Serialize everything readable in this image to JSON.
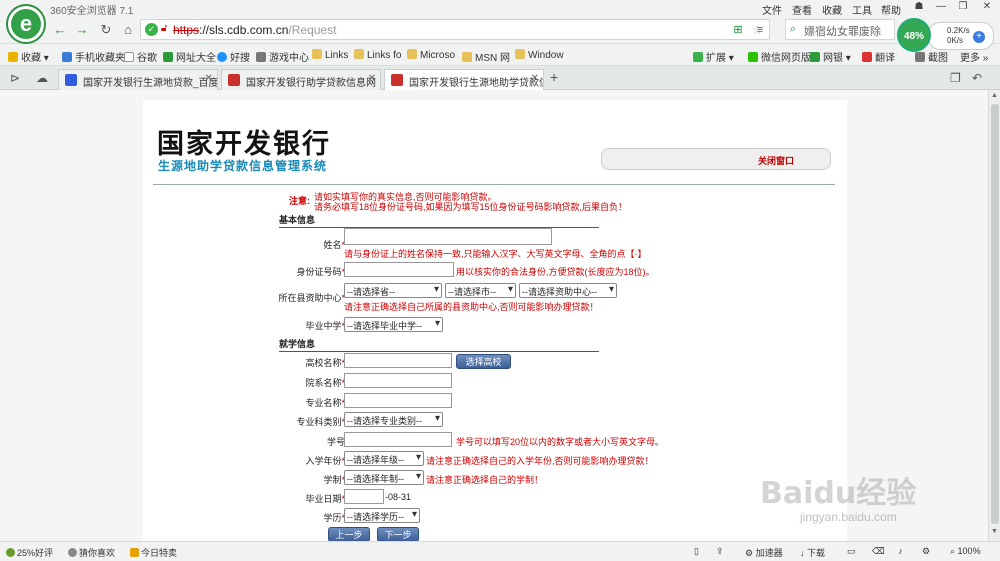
{
  "browser": {
    "app_title": "360安全浏览器 7.1",
    "menu": [
      "文件",
      "查看",
      "收藏",
      "工具",
      "帮助"
    ],
    "url_scheme": "https",
    "url_domain": "://sls.cdb.com.cn",
    "url_path": "/Request",
    "search_placeholder": "嫖宿幼女罪废除",
    "speed_percent": "48%",
    "speed_up": "0.2K/s",
    "speed_down": "0K/s"
  },
  "bookmarks": [
    "收藏",
    "手机收藏夹",
    "谷歌",
    "网址大全",
    "好搜",
    "游戏中心",
    "Links",
    "Links fo",
    "Microso",
    "MSN 网",
    "Window",
    "扩展",
    "微信网页版",
    "网银",
    "翻译",
    "截图",
    "更多"
  ],
  "tabs": [
    {
      "label": "国家开发银行生源地贷款_百度"
    },
    {
      "label": "国家开发银行助学贷款信息网"
    },
    {
      "label": "国家开发银行生源地助学贷款信"
    }
  ],
  "page": {
    "brand_title": "国家开发银行",
    "brand_subtitle": "生源地助学贷款信息管理系统",
    "close_window": "关闭窗口",
    "notice_label": "注意:",
    "notice_line1": "请如实填写你的真实信息,否则可能影响贷款。",
    "notice_line2": "请务必填写18位身份证号码,如果因为填写15位身份证号码影响贷款,后果自负！",
    "section_basic": "基本信息",
    "section_study": "就学信息",
    "fields": {
      "name_label": "姓名",
      "name_hint": "请与身份证上的姓名保持一致,只能输入汉字、大写英文字母、全角的点【·】",
      "id_label": "身份证号码",
      "id_hint": "用以核实你的合法身份,方便贷款(长度应为18位)。",
      "center_label": "所在县资助中心",
      "province_select": "--请选择省--",
      "city_select": "--请选择市--",
      "center_select": "--请选择资助中心--",
      "center_hint": "请注意正确选择自己所属的县资助中心,否则可能影响办理贷款！",
      "highschool_label": "毕业中学",
      "highschool_select": "--请选择毕业中学--",
      "college_label": "高校名称",
      "college_button": "选择高校",
      "dept_label": "院系名称",
      "major_label": "专业名称",
      "major_type_label": "专业科类别",
      "major_type_select": "--请选择专业类别--",
      "student_no_label": "学号",
      "student_no_hint": "学号可以填写20位以内的数字或者大小写英文字母。",
      "enroll_year_label": "入学年份",
      "enroll_year_select": "--请选择年级--",
      "enroll_year_hint": "请注意正确选择自己的入学年份,否则可能影响办理贷款！",
      "schooling_label": "学制",
      "schooling_select": "--请选择年制--",
      "schooling_hint": "请注意正确选择自己的学制！",
      "grad_date_label": "毕业日期",
      "grad_date_suffix": "-08-31",
      "degree_label": "学历",
      "degree_select": "--请选择学历--"
    },
    "prev_button": "上一步",
    "next_button": "下一步"
  },
  "status": {
    "rating": "25%好评",
    "guess": "猜你喜欢",
    "today": "今日特卖",
    "accelerator": "加速器",
    "download": "下载",
    "zoom": "100%"
  },
  "watermark": {
    "main": "Baidu经验",
    "sub": "jingyan.baidu.com"
  }
}
